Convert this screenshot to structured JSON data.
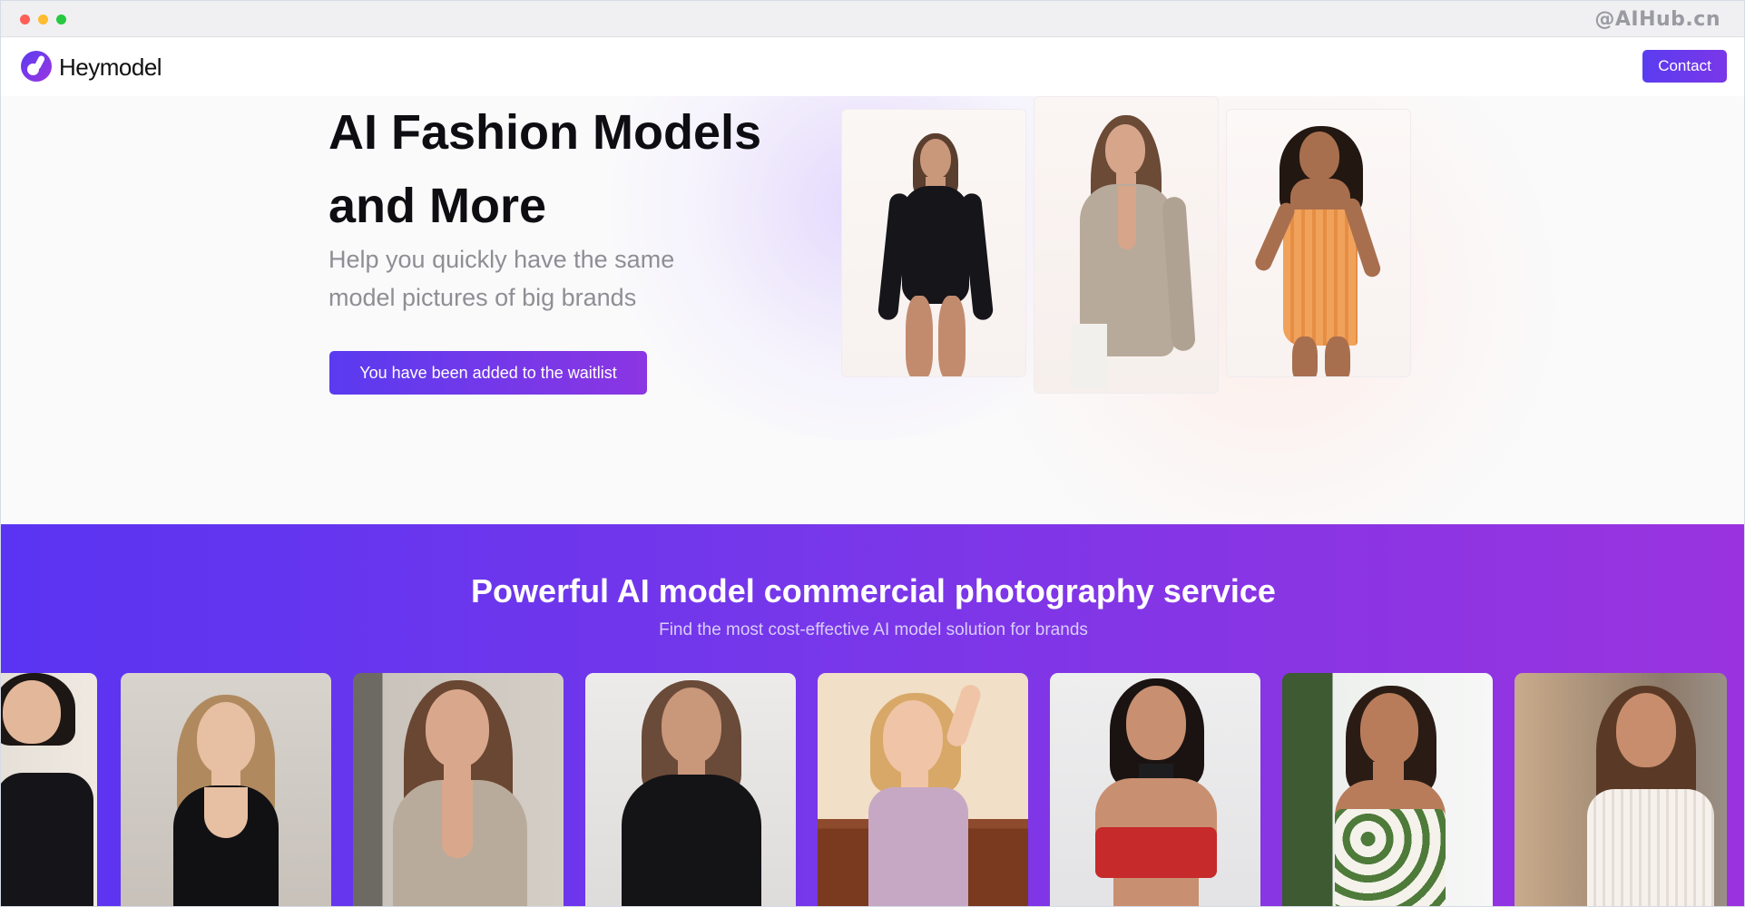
{
  "watermark": "@AIHub.cn",
  "nav": {
    "brand": "Heymodel",
    "contact_label": "Contact"
  },
  "hero": {
    "title_line1": "AI Fashion Models",
    "title_line2": "and More",
    "subtitle_line1": "Help you quickly have the same",
    "subtitle_line2": "model pictures of big brands",
    "waitlist_label": "You have been added to the waitlist"
  },
  "service": {
    "title": "Powerful AI model commercial photography service",
    "subtitle": "Find the most cost-effective AI model solution for brands"
  },
  "colors": {
    "accent_start": "#5a34f2",
    "accent_end": "#9a33df",
    "button": "#6a38ec"
  }
}
